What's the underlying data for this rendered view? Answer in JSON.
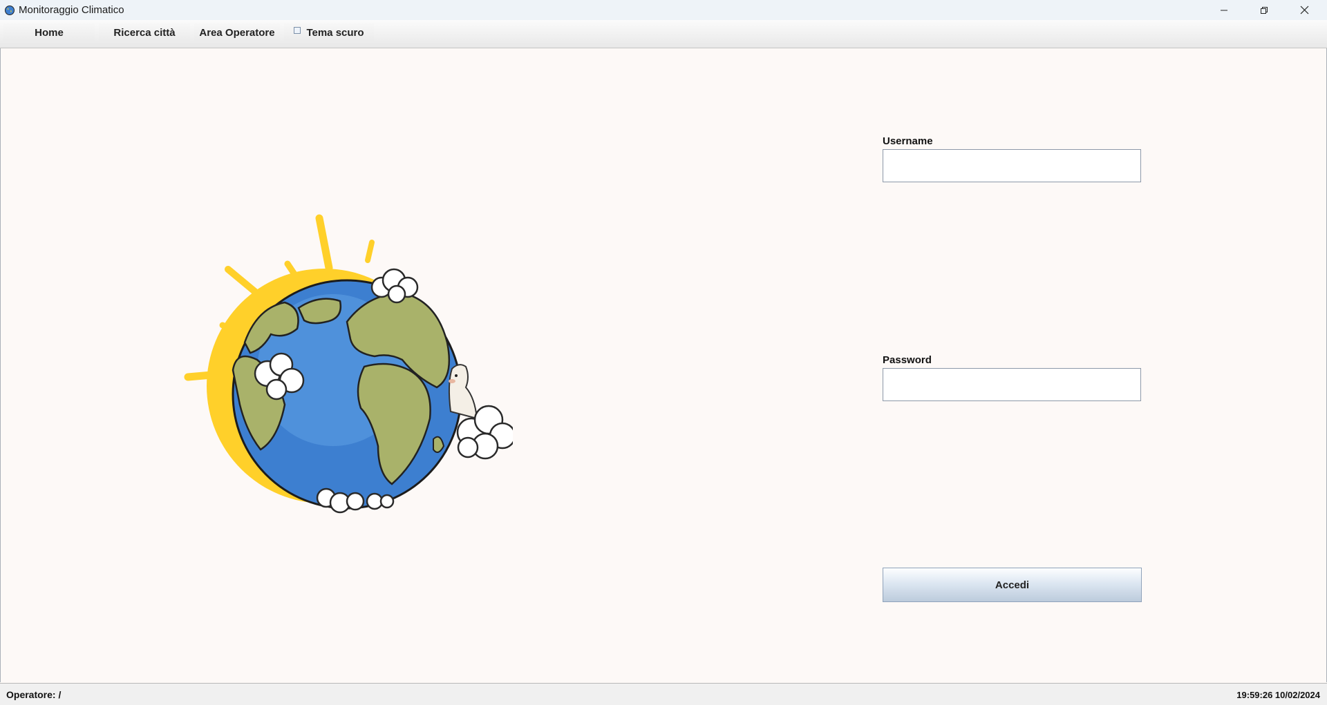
{
  "window": {
    "title": "Monitoraggio Climatico",
    "controls": [
      "minimize",
      "restore",
      "close"
    ]
  },
  "menu": {
    "home": "Home",
    "search": "Ricerca città",
    "operator_area": "Area Operatore",
    "dark_theme": "Tema scuro",
    "dark_theme_checked": false
  },
  "login": {
    "username_label": "Username",
    "username_value": "",
    "password_label": "Password",
    "password_value": "",
    "submit_label": "Accedi"
  },
  "illustration": {
    "icon": "earth-with-sun-and-llama-illustration"
  },
  "status": {
    "operator": "Operatore: /",
    "datetime": "19:59:26 10/02/2024"
  },
  "colors": {
    "background": "#fdf9f7",
    "button_gradient_end": "#bccbdc",
    "sun": "#ffd02a",
    "ocean": "#3d7fd0",
    "land": "#a9b26a"
  }
}
